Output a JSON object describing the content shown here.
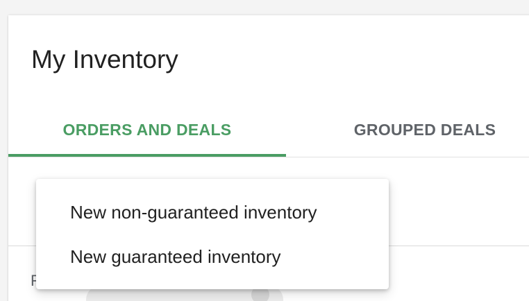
{
  "page": {
    "title": "My Inventory"
  },
  "tabs": [
    {
      "label": "ORDERS AND DEALS",
      "active": true
    },
    {
      "label": "GROUPED DEALS",
      "active": false
    }
  ],
  "menu": {
    "items": [
      {
        "label": "New non-guaranteed inventory"
      },
      {
        "label": "New guaranteed inventory"
      }
    ]
  },
  "partially_hidden": {
    "text": "F"
  },
  "colors": {
    "accent": "#4a9d63",
    "inactive_tab": "#5f6368",
    "text": "#212121",
    "background": "#f4f4f4",
    "card": "#ffffff"
  }
}
